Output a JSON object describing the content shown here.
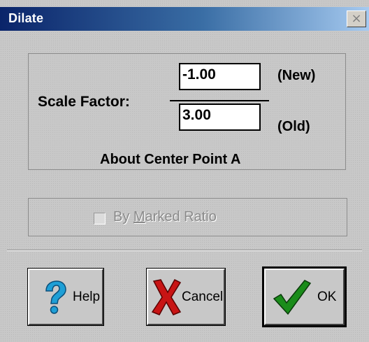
{
  "window": {
    "title": "Dilate",
    "close_glyph": "×"
  },
  "scale": {
    "label": "Scale Factor:",
    "new_value": "-1.00",
    "new_label": "(New)",
    "old_value": "3.00",
    "old_label": "(Old)",
    "center_text": "About Center Point A"
  },
  "ratio": {
    "label_prefix": "By ",
    "label_mnemonic": "M",
    "label_suffix": "arked Ratio",
    "checked": false,
    "enabled": false
  },
  "buttons": {
    "help": {
      "label": "Help",
      "icon": "question-mark-icon",
      "color": "#1e9fd6"
    },
    "cancel": {
      "label": "Cancel",
      "icon": "red-x-icon",
      "color": "#c81414"
    },
    "ok": {
      "label": "OK",
      "icon": "green-check-icon",
      "color": "#1a8c1a"
    }
  },
  "colors": {
    "title_start": "#0a246a",
    "title_end": "#a6caf0",
    "face": "#c8c8c8"
  }
}
